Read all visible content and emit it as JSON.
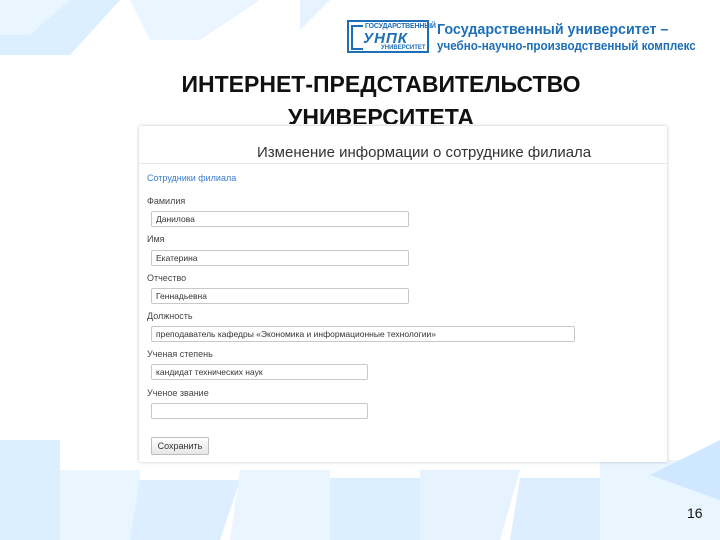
{
  "logo": {
    "line_top": "ГОСУДАРСТВЕННЫЙ",
    "line_mid": "УНПК",
    "line_bottom": "УНИВЕРСИТЕТ"
  },
  "university": {
    "title": "Государственный университет –",
    "subtitle": "учебно-научно-производственный комплекс"
  },
  "slide": {
    "title_line1": "ИНТЕРНЕТ-ПРЕДСТАВИТЕЛЬСТВО",
    "title_line2": "УНИВЕРСИТЕТА",
    "page_number": "16"
  },
  "form": {
    "header": "Изменение информации о сотруднике филиала",
    "breadcrumb": "Сотрудники филиала",
    "fields": [
      {
        "label": "Фамилия",
        "value": "Данилова"
      },
      {
        "label": "Имя",
        "value": "Екатерина"
      },
      {
        "label": "Отчество",
        "value": "Геннадьевна"
      },
      {
        "label": "Должность",
        "value": "преподаватель кафедры «Экономика и информационные технологии»"
      },
      {
        "label": "Ученая степень",
        "value": "кандидат технических наук"
      },
      {
        "label": "Ученое звание",
        "value": ""
      }
    ],
    "save_label": "Сохранить"
  },
  "colors": {
    "brand_blue": "#1d6fb8",
    "link_blue": "#3a7bd5"
  }
}
